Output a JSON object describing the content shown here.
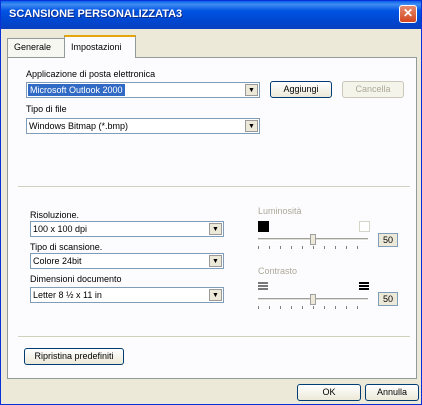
{
  "window": {
    "title": "SCANSIONE PERSONALIZZATA3"
  },
  "tabs": [
    {
      "label": "Generale"
    },
    {
      "label": "Impostazioni"
    }
  ],
  "email": {
    "label": "Applicazione di posta elettronica",
    "value": "Microsoft Outlook 2000",
    "add_label": "Aggiungi",
    "delete_label": "Cancella"
  },
  "filetype": {
    "label": "Tipo di file",
    "value": "Windows Bitmap (*.bmp)"
  },
  "resolution": {
    "label": "Risoluzione.",
    "value": "100 x 100 dpi"
  },
  "scantype": {
    "label": "Tipo di scansione.",
    "value": "Colore 24bit"
  },
  "docsize": {
    "label": "Dimensioni documento",
    "value": "Letter 8 ½ x 11 in"
  },
  "brightness": {
    "label": "Luminosità",
    "value": "50",
    "level": 0.5
  },
  "contrast": {
    "label": "Contrasto",
    "value": "50",
    "level": 0.5
  },
  "restore_label": "Ripristina predefiniti",
  "ok_label": "OK",
  "cancel_label": "Annulla"
}
